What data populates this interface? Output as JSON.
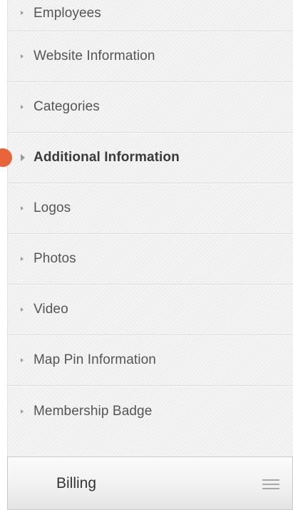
{
  "nav": {
    "items": [
      {
        "label": "Employees"
      },
      {
        "label": "Website Information"
      },
      {
        "label": "Categories"
      },
      {
        "label": "Additional Information"
      },
      {
        "label": "Logos"
      },
      {
        "label": "Photos"
      },
      {
        "label": "Video"
      },
      {
        "label": "Map Pin Information"
      },
      {
        "label": "Membership Badge"
      }
    ],
    "active_index": 3
  },
  "footer": {
    "title": "Billing",
    "menu_icon": "hamburger-menu-icon"
  },
  "colors": {
    "accent": "#e8653a",
    "text": "#555555",
    "active_text": "#3a3a3a"
  }
}
